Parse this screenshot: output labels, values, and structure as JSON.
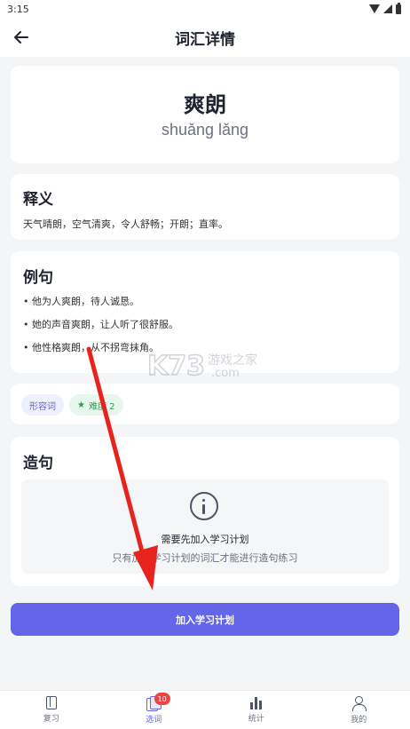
{
  "status_bar": {
    "time": "3:15"
  },
  "app_bar": {
    "title": "词汇详情"
  },
  "word_card": {
    "word": "爽朗",
    "pinyin": "shuǎng lǎng"
  },
  "meaning": {
    "title": "释义",
    "text": "天气晴朗，空气清爽，令人舒畅；开朗；直率。"
  },
  "examples": {
    "title": "例句",
    "items": [
      "• 他为人爽朗，待人诚恳。",
      "• 她的声音爽朗，让人听了很舒服。",
      "• 他性格爽朗，从不拐弯抹角。"
    ]
  },
  "tags": {
    "part_of_speech": "形容词",
    "level": "难度 2"
  },
  "sentence_making": {
    "title": "造句",
    "locked_title": "需要先加入学习计划",
    "locked_subtitle": "只有加入学习计划的词汇才能进行造句练习"
  },
  "primary_button": {
    "label": "加入学习计划"
  },
  "bottom_nav": {
    "items": [
      {
        "label": "复习",
        "icon": "book-icon"
      },
      {
        "label": "选词",
        "icon": "words-icon",
        "badge": "10",
        "active": true
      },
      {
        "label": "统计",
        "icon": "stats-icon"
      },
      {
        "label": "我的",
        "icon": "user-icon"
      }
    ]
  },
  "watermark": {
    "text_logo": "K73",
    "text_cn": "游戏之家",
    "text_domain": ".com"
  },
  "colors": {
    "accent": "#6366e8",
    "badge": "#ef4444",
    "arrow": "#e8231e"
  }
}
